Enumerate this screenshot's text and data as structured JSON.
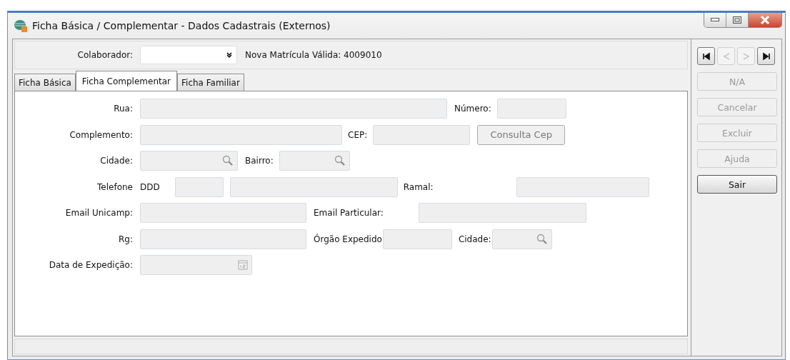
{
  "window": {
    "title": "Ficha Básica / Complementar - Dados Cadastrais (Externos)"
  },
  "colaborador": {
    "label": "Colaborador:",
    "note": "Nova Matrícula Válida: 4009010"
  },
  "tabs": [
    {
      "label": "Ficha Básica",
      "selected": false
    },
    {
      "label": "Ficha Complementar",
      "selected": true
    },
    {
      "label": "Ficha Familiar",
      "selected": false
    }
  ],
  "form_rows": [
    [
      {
        "kind": "label",
        "text": "Rua:"
      },
      {
        "kind": "field",
        "disabled": true
      },
      {
        "kind": "label",
        "text": "Número:"
      },
      {
        "kind": "field",
        "disabled": true
      }
    ],
    [
      {
        "kind": "label",
        "text": "Complemento:"
      },
      {
        "kind": "field",
        "disabled": true
      },
      {
        "kind": "label",
        "text": "CEP:"
      },
      {
        "kind": "field",
        "disabled": true
      },
      {
        "kind": "button",
        "text": "Consulta Cep",
        "disabled": true
      }
    ],
    [
      {
        "kind": "label",
        "text": "Cidade:"
      },
      {
        "kind": "lookup",
        "disabled": true
      },
      {
        "kind": "label",
        "text": "Bairro:"
      },
      {
        "kind": "lookup",
        "disabled": true
      }
    ],
    [
      {
        "kind": "label",
        "text": "Telefone"
      },
      {
        "kind": "label",
        "text": "DDD"
      },
      {
        "kind": "field",
        "disabled": true
      },
      {
        "kind": "field",
        "disabled": true
      },
      {
        "kind": "label",
        "text": "Ramal:"
      },
      {
        "kind": "field",
        "disabled": true
      }
    ],
    [
      {
        "kind": "label",
        "text": "Email Unicamp:"
      },
      {
        "kind": "field",
        "disabled": true
      },
      {
        "kind": "label",
        "text": "Email Particular:"
      },
      {
        "kind": "field",
        "disabled": true
      }
    ],
    [
      {
        "kind": "label",
        "text": "Rg:"
      },
      {
        "kind": "field",
        "disabled": true
      },
      {
        "kind": "label",
        "text": "Órgão Expedido"
      },
      {
        "kind": "field",
        "disabled": true
      },
      {
        "kind": "label",
        "text": "Cidade:"
      },
      {
        "kind": "lookup",
        "disabled": true
      }
    ],
    [
      {
        "kind": "label",
        "text": "Data de Expedição:"
      },
      {
        "kind": "date",
        "disabled": true
      }
    ]
  ],
  "nav_buttons": [
    {
      "kind": "first",
      "disabled": false
    },
    {
      "kind": "prev",
      "disabled": true
    },
    {
      "kind": "next",
      "disabled": true
    },
    {
      "kind": "last",
      "disabled": false
    }
  ],
  "side_buttons": [
    {
      "label": "N/A",
      "disabled": true
    },
    {
      "label": "Cancelar",
      "disabled": true
    },
    {
      "label": "Excluir",
      "disabled": true
    },
    {
      "label": "Ajuda",
      "disabled": true
    },
    {
      "label": "Sair",
      "disabled": false
    }
  ]
}
